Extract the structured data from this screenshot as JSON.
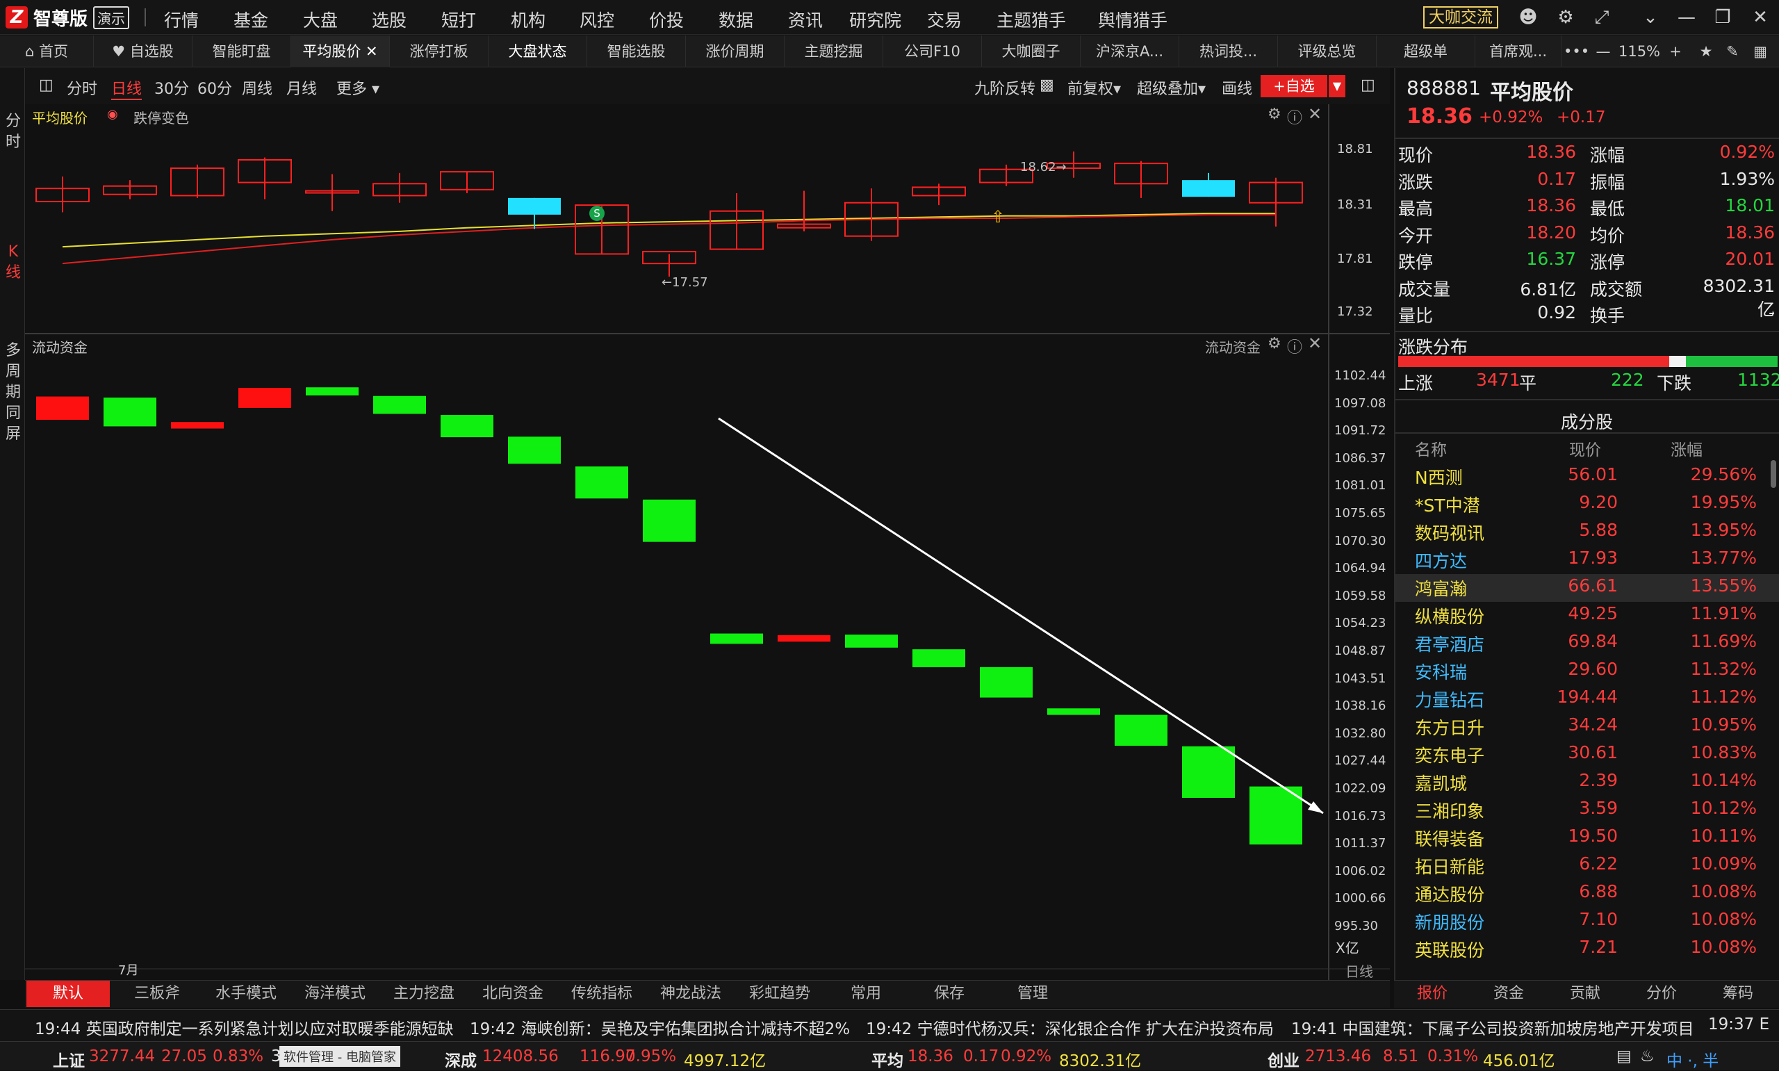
{
  "app": {
    "brand_mark": "Z",
    "name": "智尊版",
    "demo_badge": "演示",
    "dakabutton": "大咖交流"
  },
  "topnav": [
    "行情",
    "基金",
    "大盘",
    "选股",
    "短打",
    "机构",
    "风控",
    "价投",
    "数据",
    "资讯",
    "研究院",
    "交易",
    "主题猎手",
    "舆情猎手"
  ],
  "tabs": [
    "首页",
    "自选股",
    "智能盯盘",
    "平均股价",
    "涨停打板",
    "大盘状态",
    "智能选股",
    "涨价周期",
    "主题挖掘",
    "公司F10",
    "大咖圈子",
    "沪深京A...",
    "热词投...",
    "评级总览",
    "超级单",
    "首席观..."
  ],
  "zoom": "115%",
  "left_strip": {
    "a": "分时",
    "b": "K线",
    "c": "多周期同屏"
  },
  "toolbar": {
    "periods": [
      "分时",
      "日线",
      "30分",
      "60分",
      "周线",
      "月线",
      "更多"
    ],
    "right": [
      "九阶反转",
      "前复权",
      "超级叠加",
      "画线"
    ],
    "add_fav": "+自选"
  },
  "kpanel": {
    "name": "平均股价",
    "option": "跌停变色",
    "high_label": "18.62",
    "low_label": "17.57",
    "yticks": [
      "18.81",
      "18.31",
      "17.81",
      "17.32"
    ]
  },
  "fpanel": {
    "name": "流动资金",
    "name_right": "流动资金",
    "yticks": [
      "1102.44",
      "1097.08",
      "1091.72",
      "1086.37",
      "1081.01",
      "1075.65",
      "1070.30",
      "1064.94",
      "1059.58",
      "1054.23",
      "1048.87",
      "1043.51",
      "1038.16",
      "1032.80",
      "1027.44",
      "1022.09",
      "1016.73",
      "1011.37",
      "1006.02",
      "1000.66",
      "995.30"
    ],
    "unit": "X亿",
    "xlabel": "7月",
    "period_label": "日线"
  },
  "chart_data": [
    {
      "type": "candlestick",
      "series_name": "平均股价",
      "ohlc": [
        [
          18.2,
          18.41,
          18.11,
          18.31
        ],
        [
          18.26,
          18.38,
          18.22,
          18.33
        ],
        [
          18.25,
          18.51,
          18.23,
          18.48
        ],
        [
          18.36,
          18.57,
          18.22,
          18.55
        ],
        [
          18.29,
          18.43,
          18.12,
          18.29
        ],
        [
          18.25,
          18.44,
          18.19,
          18.35
        ],
        [
          18.3,
          18.45,
          18.27,
          18.45
        ],
        [
          18.23,
          18.23,
          17.97,
          18.09
        ],
        [
          17.76,
          18.16,
          17.76,
          18.17
        ],
        [
          17.68,
          17.76,
          17.57,
          17.78
        ],
        [
          17.8,
          18.27,
          17.8,
          18.12
        ],
        [
          17.98,
          18.29,
          17.95,
          18.01
        ],
        [
          17.91,
          18.31,
          17.87,
          18.19
        ],
        [
          18.25,
          18.35,
          18.17,
          18.32
        ],
        [
          18.36,
          18.51,
          18.33,
          18.47
        ],
        [
          18.48,
          18.62,
          18.4,
          18.52
        ],
        [
          18.35,
          18.54,
          18.23,
          18.52
        ],
        [
          18.38,
          18.44,
          18.24,
          18.24
        ],
        [
          18.19,
          18.4,
          17.99,
          18.36
        ]
      ],
      "ma_yellow": [
        17.82,
        17.85,
        17.88,
        17.91,
        17.93,
        17.95,
        17.98,
        18.0,
        18.02,
        18.03,
        18.04,
        18.05,
        18.06,
        18.07,
        18.08,
        18.08,
        18.09,
        18.1,
        18.1
      ],
      "ma_red": [
        17.68,
        17.73,
        17.78,
        17.83,
        17.88,
        17.92,
        17.95,
        17.98,
        18.0,
        18.01,
        18.02,
        18.04,
        18.05,
        18.06,
        18.06,
        18.07,
        18.08,
        18.09,
        18.09
      ],
      "ylim": [
        17.15,
        18.9
      ]
    },
    {
      "type": "waterfall",
      "series_name": "流动资金",
      "unit": "亿",
      "bars": [
        [
          1098.5,
          1094.2
        ],
        [
          1098.3,
          1093.0
        ],
        [
          1093.8,
          1092.6
        ],
        [
          1100.1,
          1096.4
        ],
        [
          1100.2,
          1098.7
        ],
        [
          1098.6,
          1095.3
        ],
        [
          1095.1,
          1091.0
        ],
        [
          1091.1,
          1086.1
        ],
        [
          1085.6,
          1079.7
        ],
        [
          1079.5,
          1071.7
        ],
        [
          1054.8,
          1052.9
        ],
        [
          1054.5,
          1053.3
        ],
        [
          1054.6,
          1052.2
        ],
        [
          1051.9,
          1048.6
        ],
        [
          1048.6,
          1043.0
        ],
        [
          1041.0,
          1039.8
        ],
        [
          1039.8,
          1034.1
        ],
        [
          1034.0,
          1024.5
        ],
        [
          1026.6,
          1015.9
        ]
      ],
      "colors": [
        "red",
        "green",
        "red",
        "red",
        "green",
        "green",
        "green",
        "green",
        "green",
        "green",
        "green",
        "red",
        "green",
        "green",
        "green",
        "green",
        "green",
        "green",
        "green"
      ],
      "ylim": [
        994.0,
        1106.0
      ]
    }
  ],
  "quote": {
    "code": "888881",
    "name": "平均股价",
    "price": "18.36",
    "pct": "+0.92%",
    "chg": "+0.17",
    "rows": [
      [
        "现价",
        "18.36",
        "涨幅",
        "0.92%"
      ],
      [
        "涨跌",
        "0.17",
        "振幅",
        "1.93%"
      ],
      [
        "最高",
        "18.36",
        "最低",
        "18.01"
      ],
      [
        "今开",
        "18.20",
        "均价",
        "18.36"
      ],
      [
        "跌停",
        "16.37",
        "涨停",
        "20.01"
      ],
      [
        "成交量",
        "6.81亿",
        "成交额",
        "8302.31亿"
      ],
      [
        "量比",
        "0.92",
        "换手",
        "-"
      ]
    ]
  },
  "dist": {
    "title": "涨跌分布",
    "up_label": "上涨",
    "up": "3471",
    "flat_label": "平",
    "flat": "222",
    "down_label": "下跌",
    "down": "1132"
  },
  "constituents": {
    "title": "成分股",
    "headers": [
      "名称",
      "现价",
      "涨幅"
    ],
    "rows": [
      [
        "N西测",
        "56.01",
        "29.56%"
      ],
      [
        "*ST中潜",
        "9.20",
        "19.95%"
      ],
      [
        "数码视讯",
        "5.88",
        "13.95%"
      ],
      [
        "四方达",
        "17.93",
        "13.77%"
      ],
      [
        "鸿富瀚",
        "66.61",
        "13.55%"
      ],
      [
        "纵横股份",
        "49.25",
        "11.91%"
      ],
      [
        "君亭酒店",
        "69.84",
        "11.69%"
      ],
      [
        "安科瑞",
        "29.60",
        "11.32%"
      ],
      [
        "力量钻石",
        "194.44",
        "11.12%"
      ],
      [
        "东方日升",
        "34.24",
        "10.95%"
      ],
      [
        "奕东电子",
        "30.61",
        "10.83%"
      ],
      [
        "嘉凯城",
        "2.39",
        "10.14%"
      ],
      [
        "三湘印象",
        "3.59",
        "10.12%"
      ],
      [
        "联得装备",
        "19.50",
        "10.11%"
      ],
      [
        "拓日新能",
        "6.22",
        "10.09%"
      ],
      [
        "通达股份",
        "6.88",
        "10.08%"
      ],
      [
        "新朋股份",
        "7.10",
        "10.08%"
      ],
      [
        "英联股份",
        "7.21",
        "10.08%"
      ]
    ],
    "name_colors": [
      "yellow",
      "yellow",
      "yellow",
      "cyan",
      "yellow",
      "yellow",
      "cyan",
      "cyan",
      "cyan",
      "yellow",
      "yellow",
      "yellow",
      "yellow",
      "yellow",
      "yellow",
      "yellow",
      "cyan",
      "yellow"
    ]
  },
  "bottom_tabs": [
    "默认",
    "三板斧",
    "水手模式",
    "海洋模式",
    "主力挖盘",
    "北向资金",
    "传统指标",
    "神龙战法",
    "彩虹趋势",
    "常用",
    "保存",
    "管理"
  ],
  "right_tabs": [
    "报价",
    "资金",
    "贡献",
    "分价",
    "筹码"
  ],
  "news": [
    {
      "time": "19:44",
      "text": "英国政府制定一系列紧急计划以应对取暖季能源短缺"
    },
    {
      "time": "19:42",
      "text": "海峡创新：吴艳及宇佑集团拟合计减持不超2%"
    },
    {
      "time": "19:42",
      "text": "宁德时代杨汉兵：深化银企合作 扩大在沪投资布局"
    },
    {
      "time": "19:41",
      "text": "中国建筑：下属子公司投资新加坡房地产开发项目"
    }
  ],
  "clock": "19:37 E",
  "indices": [
    {
      "name": "上证",
      "val": "3277.44",
      "chg": "27.05",
      "pct": "0.83%",
      "amt": "3"
    },
    {
      "name": "深成",
      "val": "12408.56",
      "chg": "116.97",
      "pct": "0.95%",
      "amt": "4997.12亿"
    },
    {
      "name": "平均",
      "val": "18.36",
      "chg": "0.17",
      "pct": "0.92%",
      "amt": "8302.31亿"
    },
    {
      "name": "创业",
      "val": "2713.46",
      "chg": "8.51",
      "pct": "0.31%",
      "amt": "456.01亿"
    }
  ],
  "popup": "软件管理 - 电脑管家",
  "ime": "中 ·, 半"
}
